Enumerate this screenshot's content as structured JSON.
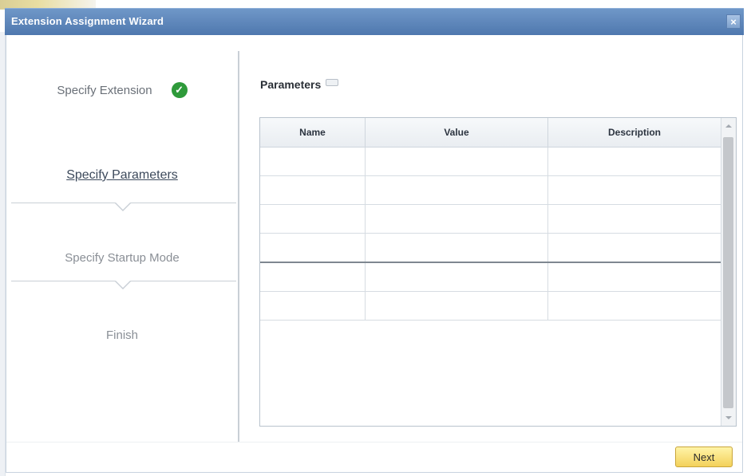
{
  "window": {
    "title": "Extension Assignment Wizard",
    "close_glyph": "×"
  },
  "steps": [
    {
      "label": "Specify Extension",
      "state": "completed",
      "icon": "check-icon"
    },
    {
      "label": "Specify Parameters",
      "state": "active"
    },
    {
      "label": "Specify Startup Mode",
      "state": "pending"
    },
    {
      "label": "Finish",
      "state": "pending"
    }
  ],
  "parameters": {
    "title": "Parameters",
    "columns": [
      "Name",
      "Value",
      "Description"
    ],
    "rows": [
      [
        "",
        "",
        ""
      ],
      [
        "",
        "",
        ""
      ],
      [
        "",
        "",
        ""
      ],
      [
        "",
        "",
        ""
      ],
      [
        "",
        "",
        ""
      ],
      [
        "",
        "",
        ""
      ]
    ]
  },
  "footer": {
    "next_label": "Next"
  },
  "colors": {
    "titlebar": "#5b84ba",
    "check": "#2e9a3a",
    "next_button": "#f6d86a"
  }
}
